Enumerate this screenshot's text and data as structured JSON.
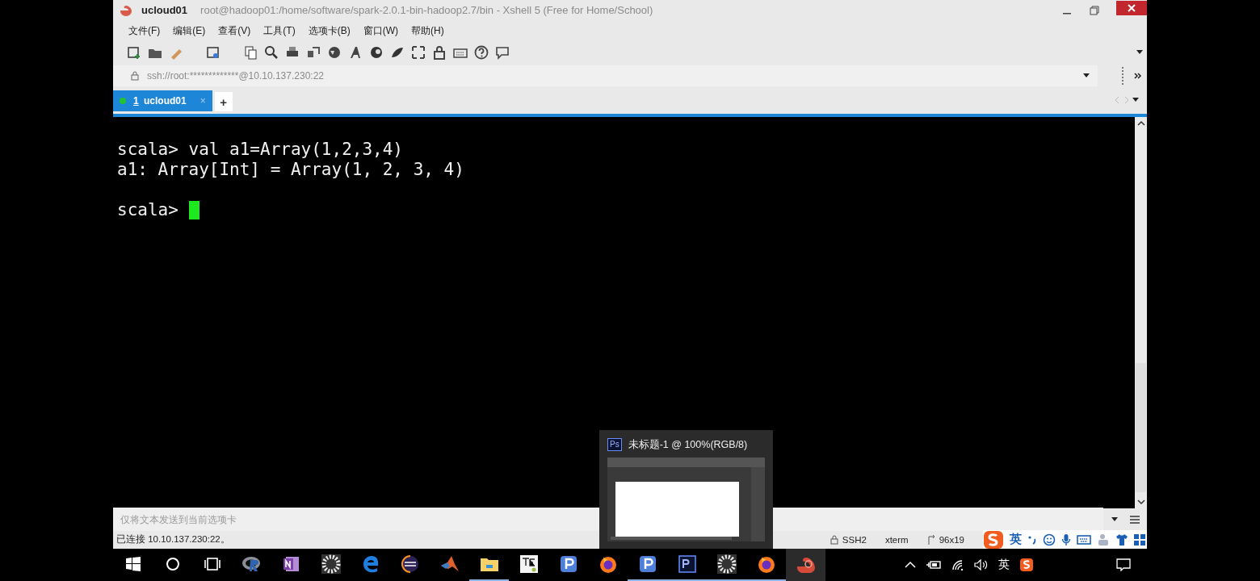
{
  "window": {
    "app_name": "ucloud01",
    "title": "root@hadoop01:/home/software/spark-2.0.1-bin-hadoop2.7/bin - Xshell 5 (Free for Home/School)"
  },
  "menu": [
    "文件(F)",
    "编辑(E)",
    "查看(V)",
    "工具(T)",
    "选项卡(B)",
    "窗口(W)",
    "帮助(H)"
  ],
  "address": {
    "value": "ssh://root:*************@10.10.137.230:22"
  },
  "tabs": [
    {
      "number": "1",
      "label": "ucloud01",
      "close": "×",
      "selected": true
    }
  ],
  "add_tab": "+",
  "terminal": {
    "lines": [
      {
        "kind": "output",
        "text": "scala> val a1=Array(1,2,3,4)"
      },
      {
        "kind": "output",
        "text": "a1: Array[Int] = Array(1, 2, 3, 4)"
      },
      {
        "kind": "blank"
      },
      {
        "kind": "prompt",
        "text": "scala>"
      }
    ]
  },
  "send_bar": {
    "placeholder": "仅将文本发送到当前选项卡"
  },
  "status_bar": {
    "connection": "已连接 10.10.137.230:22。",
    "protocol": "SSH2",
    "terminal_type": "xterm",
    "size": "96x19"
  },
  "ime_bar": {
    "mode": "英"
  },
  "taskbar_preview": {
    "badge": "Ps",
    "title": "未标题-1 @ 100%(RGB/8)"
  },
  "taskbar": {
    "apps": [
      {
        "kind": "start",
        "running": false,
        "selected": false
      },
      {
        "kind": "search",
        "running": false,
        "selected": false
      },
      {
        "kind": "taskview",
        "running": false,
        "selected": false
      },
      {
        "kind": "r",
        "running": false,
        "selected": false
      },
      {
        "kind": "onenote",
        "running": false,
        "selected": false
      },
      {
        "kind": "fan",
        "running": false,
        "selected": false
      },
      {
        "kind": "edge",
        "running": false,
        "selected": false
      },
      {
        "kind": "eclipse",
        "running": false,
        "selected": false
      },
      {
        "kind": "matlab",
        "running": false,
        "selected": false
      },
      {
        "kind": "folder",
        "running": true,
        "selected": false
      },
      {
        "kind": "tex",
        "running": false,
        "selected": false
      },
      {
        "kind": "p",
        "running": false,
        "selected": false
      },
      {
        "kind": "firefox",
        "running": false,
        "selected": false
      },
      {
        "kind": "p",
        "running": true,
        "selected": false
      },
      {
        "kind": "ps",
        "running": true,
        "selected": false
      },
      {
        "kind": "fan",
        "running": true,
        "selected": false
      },
      {
        "kind": "firefox",
        "running": true,
        "selected": false
      },
      {
        "kind": "xshell",
        "running": false,
        "selected": true
      }
    ],
    "ime": "英"
  }
}
